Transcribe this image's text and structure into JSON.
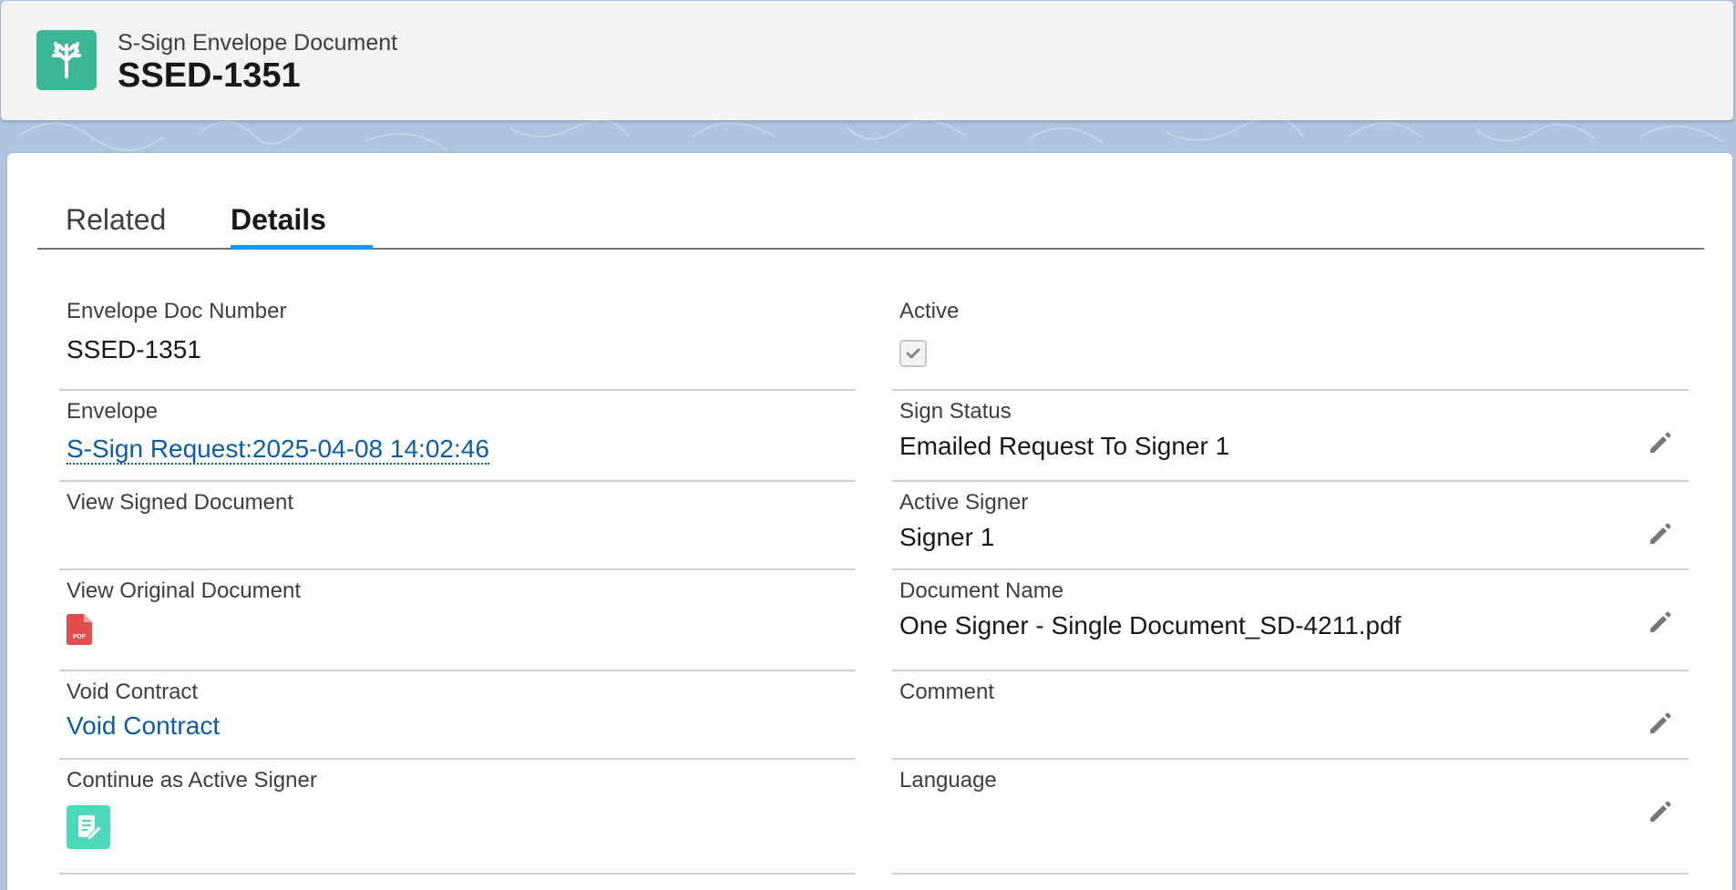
{
  "header": {
    "object_type": "S-Sign Envelope Document",
    "record_name": "SSED-1351",
    "icon": "ssign-tree-icon"
  },
  "tabs": [
    {
      "label": "Related",
      "active": false
    },
    {
      "label": "Details",
      "active": true
    }
  ],
  "fields": {
    "envelope_doc_number": {
      "label": "Envelope Doc Number",
      "value": "SSED-1351"
    },
    "envelope": {
      "label": "Envelope",
      "value": "S-Sign Request:2025-04-08 14:02:46"
    },
    "view_signed_document": {
      "label": "View Signed Document",
      "value": ""
    },
    "view_original_document": {
      "label": "View Original Document",
      "icon": "pdf-file-icon",
      "icon_text": "PDF"
    },
    "void_contract": {
      "label": "Void Contract",
      "value": "Void Contract"
    },
    "continue_as_active_signer": {
      "label": "Continue as Active Signer",
      "icon": "sign-document-icon"
    },
    "active": {
      "label": "Active",
      "checked": true
    },
    "sign_status": {
      "label": "Sign Status",
      "value": "Emailed Request To Signer 1"
    },
    "active_signer": {
      "label": "Active Signer",
      "value": "Signer 1"
    },
    "document_name": {
      "label": "Document Name",
      "value": "One Signer - Single Document_SD-4211.pdf"
    },
    "comment": {
      "label": "Comment",
      "value": ""
    },
    "language": {
      "label": "Language",
      "value": ""
    }
  },
  "colors": {
    "brand_icon": "#3ab795",
    "link": "#0b5cab",
    "tab_active": "#1b96ff",
    "signer_icon": "#4dd8b8",
    "pdf_red": "#e04e4e"
  }
}
